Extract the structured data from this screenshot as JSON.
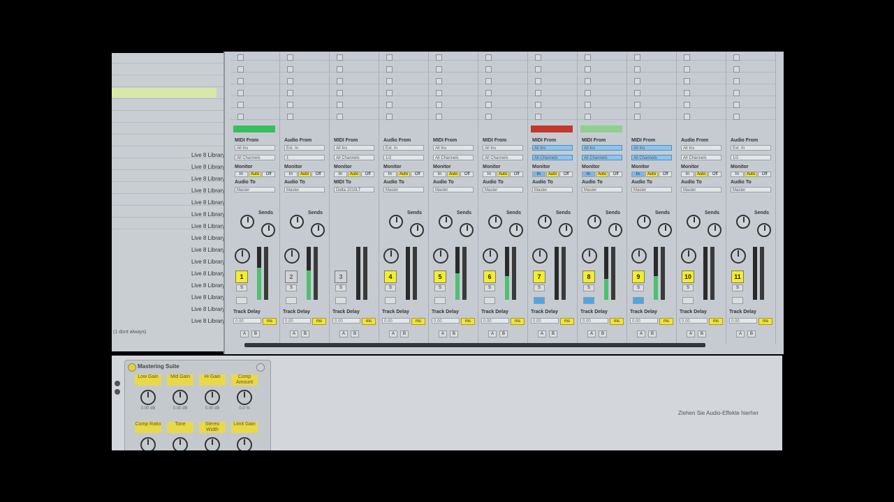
{
  "browser": {
    "items": [
      "Live 8 Library",
      "Live 8 Library",
      "Live 8 Library",
      "Live 8 Library",
      "Live 8 Library",
      "Live 8 Library",
      "Live 8 Library",
      "Live 8 Library",
      "Live 8 Library",
      "Live 8 Library",
      "Live 8 Library",
      "Live 8 Library",
      "Live 8 Library",
      "Live 8 Library",
      "Live 8 Library"
    ],
    "status": "(1 dont always)"
  },
  "labels": {
    "midi_from": "MIDI From",
    "audio_from": "Audio From",
    "monitor": "Monitor",
    "audio_to": "Audio To",
    "midi_to": "MIDI To",
    "sends": "Sends",
    "track_delay": "Track Delay",
    "ms": "ms",
    "in": "In",
    "auto": "Auto",
    "off": "Off",
    "a": "A",
    "b": "B",
    "s": "S"
  },
  "tracks": [
    {
      "num": "1",
      "type": "MIDI From",
      "src": "All Ins",
      "ch": "All Channels",
      "to_label": "Audio To",
      "to": "Master",
      "delay": "0.00",
      "active": true
    },
    {
      "num": "2",
      "type": "Audio From",
      "src": "Ext. In",
      "ch": "1",
      "to_label": "Audio To",
      "to": "Master",
      "delay": "0.00",
      "active": false
    },
    {
      "num": "3",
      "type": "MIDI From",
      "src": "All Ins",
      "ch": "All Channels",
      "to_label": "MIDI To",
      "to": "Delta 1010LT",
      "delay": "0.00",
      "active": false
    },
    {
      "num": "4",
      "type": "Audio From",
      "src": "Ext. In",
      "ch": "1/2",
      "to_label": "Audio To",
      "to": "Master",
      "delay": "0.00",
      "active": true
    },
    {
      "num": "5",
      "type": "MIDI From",
      "src": "All Ins",
      "ch": "All Channels",
      "to_label": "Audio To",
      "to": "Master",
      "delay": "0.00",
      "active": true
    },
    {
      "num": "6",
      "type": "MIDI From",
      "src": "All Ins",
      "ch": "All Channels",
      "to_label": "Audio To",
      "to": "Master",
      "delay": "0.00",
      "active": true
    },
    {
      "num": "7",
      "type": "MIDI From",
      "src": "All Ins",
      "ch": "All Channels",
      "to_label": "Audio To",
      "to": "Master",
      "delay": "0.00",
      "active": true
    },
    {
      "num": "8",
      "type": "MIDI From",
      "src": "All Ins",
      "ch": "All Channels",
      "to_label": "Audio To",
      "to": "Master",
      "delay": "0.00",
      "active": true
    },
    {
      "num": "9",
      "type": "MIDI From",
      "src": "All Ins",
      "ch": "All Channels",
      "to_label": "Audio To",
      "to": "Master",
      "delay": "0.00",
      "active": true
    },
    {
      "num": "10",
      "type": "Audio From",
      "src": "All Ins",
      "ch": "All Channels",
      "to_label": "Audio To",
      "to": "Master",
      "delay": "0.00",
      "active": true
    },
    {
      "num": "11",
      "type": "Audio From",
      "src": "Ext. In",
      "ch": "1/2",
      "to_label": "Audio To",
      "to": "Master",
      "delay": "0.00",
      "active": true
    }
  ],
  "device": {
    "title": "Mastering Suite",
    "macros_top": [
      {
        "label": "Low Gain",
        "value": "0.00 dB"
      },
      {
        "label": "Mid Gain",
        "value": "0.00 dB"
      },
      {
        "label": "Hi Gain",
        "value": "0.00 dB"
      },
      {
        "label": "Comp Amount",
        "value": "0.0 %"
      }
    ],
    "macros_bottom": [
      {
        "label": "Comp Ratio",
        "value": ""
      },
      {
        "label": "Tone",
        "value": ""
      },
      {
        "label": "Stereo Width",
        "value": ""
      },
      {
        "label": "Limit Gain",
        "value": ""
      }
    ],
    "drop_hint": "Ziehen Sie Audio-Effekte hierher"
  },
  "colors": {
    "accent_yellow": "#f4ee2a",
    "monitor_blue": "#79b9e8",
    "meter_green": "#4ec070",
    "clip_red": "#c0392b"
  }
}
